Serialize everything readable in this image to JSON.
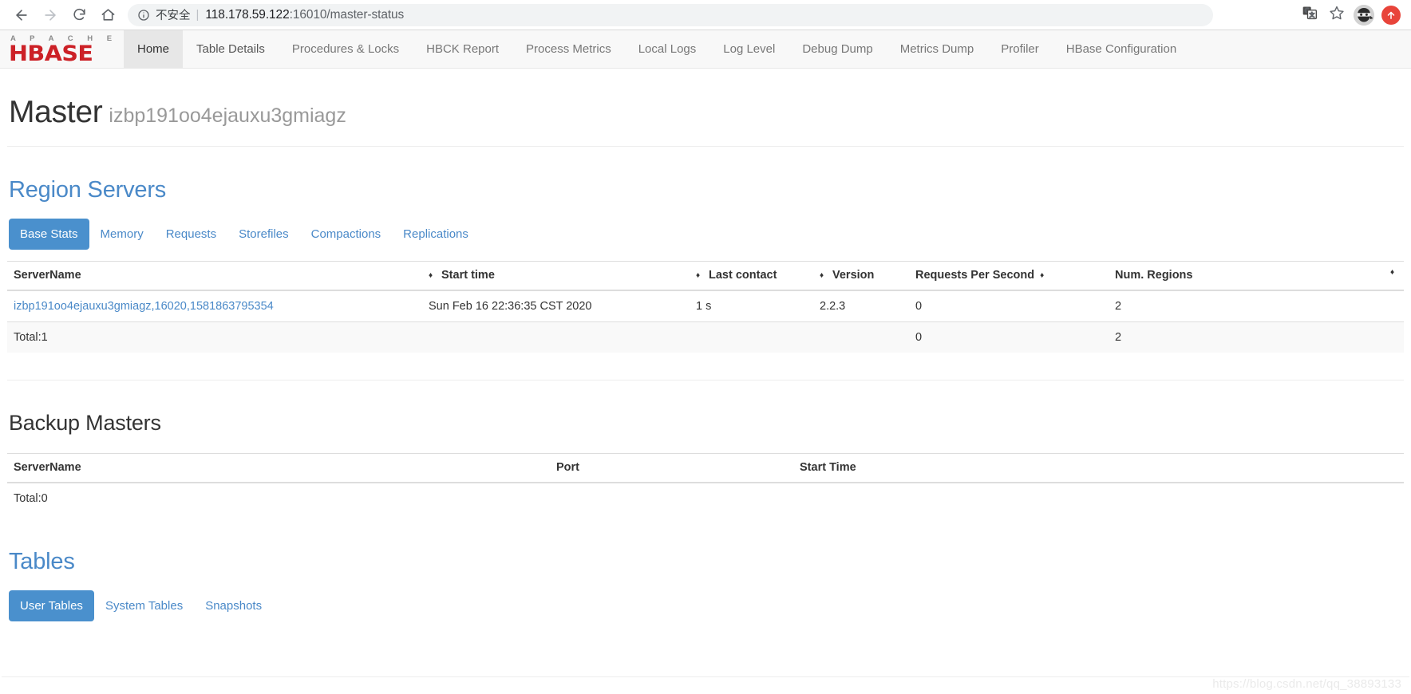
{
  "browser": {
    "back_icon": "back-arrow-icon",
    "forward_icon": "forward-arrow-icon",
    "reload_icon": "reload-icon",
    "home_icon": "home-icon",
    "security_label": "不安全",
    "url_separator": "|",
    "url_host": "118.178.59.122",
    "url_path": ":16010/master-status",
    "url_full": "118.178.59.122:16010/master-status",
    "translate_icon": "translate-icon",
    "bookmark_icon": "star-icon",
    "profile_icon": "profile-avatar-icon",
    "update_icon": "update-arrow-icon"
  },
  "navbar": {
    "logo_top": "A P A C H E",
    "logo_main": "HBASE",
    "items": [
      {
        "label": "Home",
        "state": "hovered"
      },
      {
        "label": "Table Details",
        "state": "active"
      },
      {
        "label": "Procedures & Locks",
        "state": "normal"
      },
      {
        "label": "HBCK Report",
        "state": "normal"
      },
      {
        "label": "Process Metrics",
        "state": "normal"
      },
      {
        "label": "Local Logs",
        "state": "normal"
      },
      {
        "label": "Log Level",
        "state": "normal"
      },
      {
        "label": "Debug Dump",
        "state": "normal"
      },
      {
        "label": "Metrics Dump",
        "state": "normal"
      },
      {
        "label": "Profiler",
        "state": "normal"
      },
      {
        "label": "HBase Configuration",
        "state": "normal"
      }
    ]
  },
  "header": {
    "title": "Master",
    "subtitle": "izbp191oo4ejauxu3gmiagz"
  },
  "region_servers": {
    "title": "Region Servers",
    "tabs": [
      {
        "label": "Base Stats",
        "active": true
      },
      {
        "label": "Memory",
        "active": false
      },
      {
        "label": "Requests",
        "active": false
      },
      {
        "label": "Storefiles",
        "active": false
      },
      {
        "label": "Compactions",
        "active": false
      },
      {
        "label": "Replications",
        "active": false
      }
    ],
    "columns": [
      "ServerName",
      "Start time",
      "Last contact",
      "Version",
      "Requests Per Second",
      "Num. Regions"
    ],
    "rows": [
      {
        "server_name": "izbp191oo4ejauxu3gmiagz,16020,1581863795354",
        "start_time": "Sun Feb 16 22:36:35 CST 2020",
        "last_contact": "1 s",
        "version": "2.2.3",
        "requests_per_second": "0",
        "num_regions": "2"
      }
    ],
    "total": {
      "label": "Total:1",
      "requests_per_second": "0",
      "num_regions": "2"
    }
  },
  "backup_masters": {
    "title": "Backup Masters",
    "columns": [
      "ServerName",
      "Port",
      "Start Time"
    ],
    "rows": [],
    "total": {
      "label": "Total:0"
    }
  },
  "tables": {
    "title": "Tables",
    "tabs": [
      {
        "label": "User Tables",
        "active": true
      },
      {
        "label": "System Tables",
        "active": false
      },
      {
        "label": "Snapshots",
        "active": false
      }
    ]
  },
  "watermark": "https://blog.csdn.net/qq_38893133",
  "colors": {
    "accent_blue": "#4a89c8",
    "pill_active_bg": "#4a90cd",
    "hbase_red": "#cc2127",
    "update_red": "#e8443a",
    "text_dark": "#333333",
    "text_muted": "#999999"
  }
}
